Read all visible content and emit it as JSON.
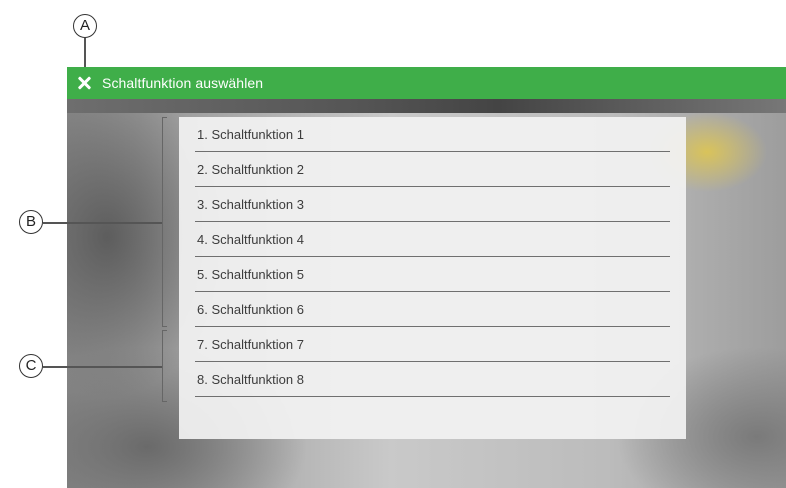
{
  "window": {
    "title": "Schaltfunktion auswählen",
    "close_icon": "close-icon"
  },
  "list": {
    "items": [
      {
        "label": "1. Schaltfunktion 1"
      },
      {
        "label": "2. Schaltfunktion 2"
      },
      {
        "label": "3. Schaltfunktion 3"
      },
      {
        "label": "4. Schaltfunktion 4"
      },
      {
        "label": "5. Schaltfunktion 5"
      },
      {
        "label": "6. Schaltfunktion 6"
      },
      {
        "label": "7. Schaltfunktion 7"
      },
      {
        "label": "8. Schaltfunktion 8"
      }
    ]
  },
  "annotations": {
    "a": "A",
    "b": "B",
    "c": "C"
  },
  "colors": {
    "title_bar": "#3fae49",
    "title_text": "#ffffff",
    "list_background": "#f2f2f2",
    "divider": "#6f6f6f"
  }
}
